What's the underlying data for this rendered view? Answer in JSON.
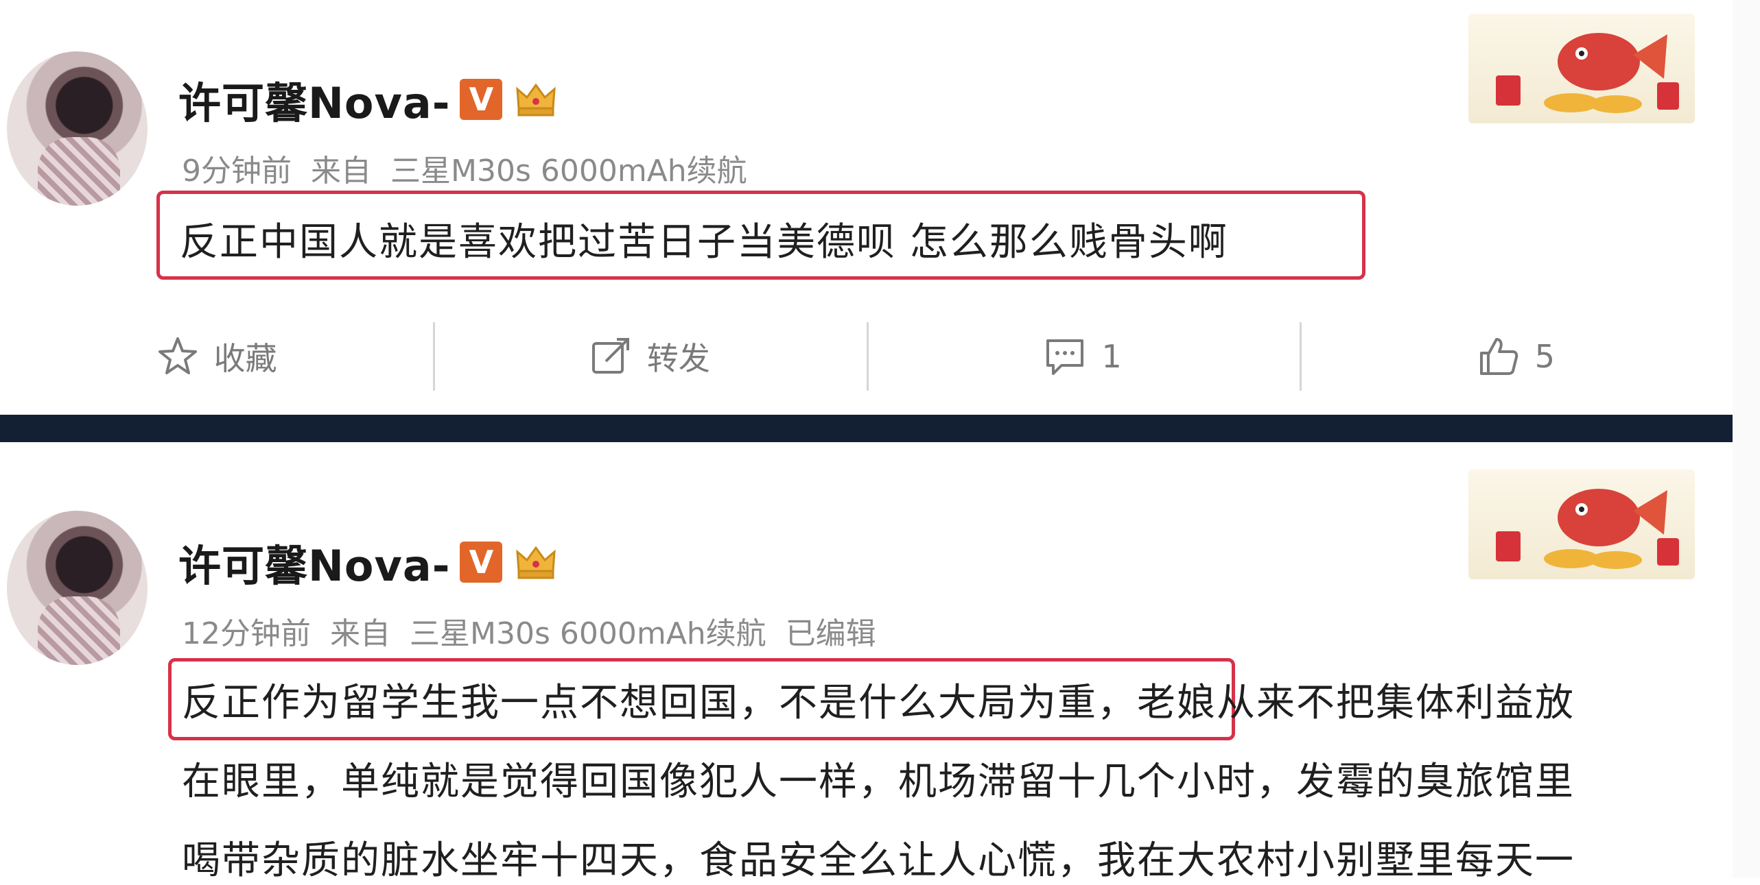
{
  "posts": [
    {
      "username": "许可馨Nova-",
      "verified_badge": "V",
      "time": "9分钟前",
      "source_prefix": "来自",
      "device": "三星M30s 6000mAh续航",
      "edited": "",
      "body_lines": [
        "反正中国人就是喜欢把过苦日子当美德呗 怎么那么贱骨头啊"
      ],
      "actions": {
        "favorite_label": "收藏",
        "repost_label": "转发",
        "comment_count": "1",
        "like_count": "5"
      }
    },
    {
      "username": "许可馨Nova-",
      "verified_badge": "V",
      "time": "12分钟前",
      "source_prefix": "来自",
      "device": "三星M30s 6000mAh续航",
      "edited": "已编辑",
      "body_lines": [
        "反正作为留学生我一点不想回国，不是什么大局为重，老娘从来不把集体利益放",
        "在眼里，单纯就是觉得回国像犯人一样，机场滞留十几个小时，发霉的臭旅馆里",
        "喝带杂质的脏水坐牢十四天，食品安全么让人心慌，我在大农村小别墅里每天一"
      ]
    }
  ],
  "colors": {
    "highlight_border": "#d6324a",
    "badge_orange": "#e2662a",
    "divider": "#132033",
    "meta_text": "#8a8a8a"
  },
  "icons": [
    "star-icon",
    "repost-icon",
    "comment-icon",
    "thumbs-up-icon",
    "crown-icon"
  ]
}
